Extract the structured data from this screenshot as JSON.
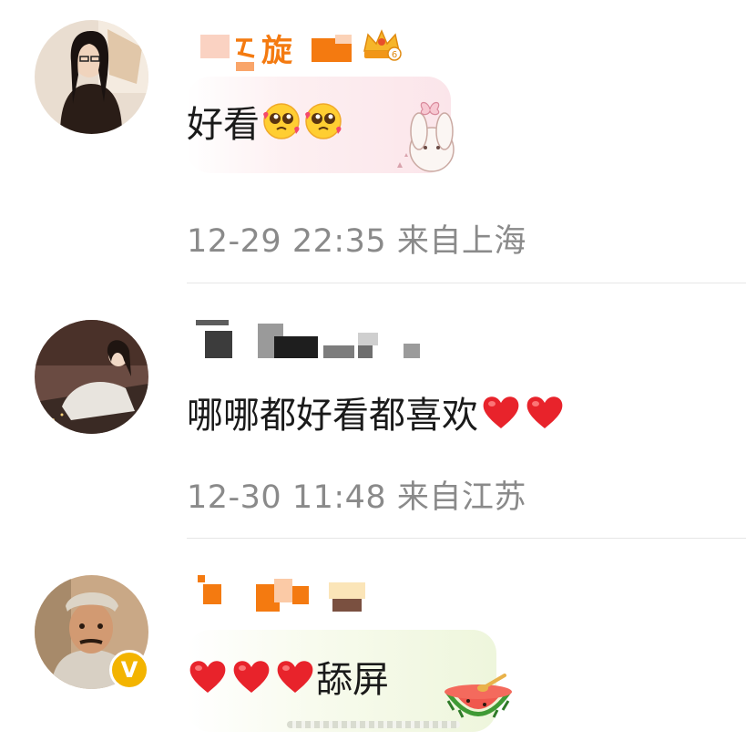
{
  "comments": [
    {
      "username_visible": "旋",
      "text": "好看",
      "emojis": [
        "pleading-face-icon",
        "pleading-face-icon"
      ],
      "meta": "12-29 22:35 来自上海",
      "badge": "crown-badge-icon"
    },
    {
      "text": "哪哪都好看都喜欢",
      "emojis": [
        "red-heart-icon",
        "red-heart-icon"
      ],
      "meta": "12-30 11:48 来自江苏"
    },
    {
      "text": "舔屏",
      "emojis": [
        "red-heart-icon",
        "red-heart-icon",
        "red-heart-icon"
      ],
      "verified_badge": "V",
      "sticker": "watermelon-sticker-icon"
    }
  ],
  "colors": {
    "name_orange": "#f47a10",
    "meta_gray": "#8a8a8a",
    "heart_red": "#e8232b",
    "verified_gold": "#f3b400"
  }
}
